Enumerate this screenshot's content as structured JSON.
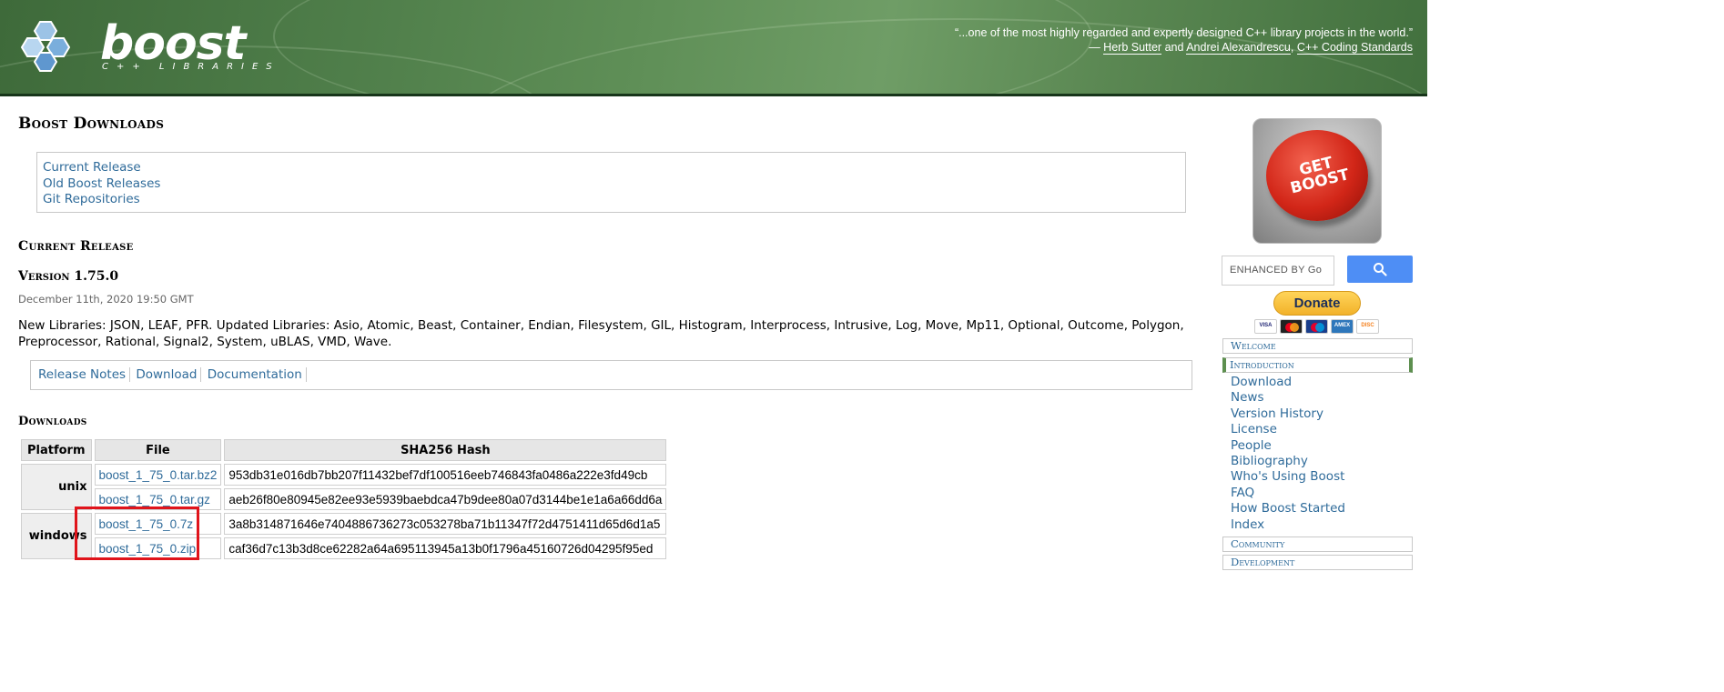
{
  "header": {
    "logo_word": "boost",
    "logo_sub": "C++ LIBRARIES",
    "quote_line1": "“...one of the most highly regarded and expertly designed C++ library projects in the world.”",
    "quote_dash": "— ",
    "quote_author1": "Herb Sutter",
    "quote_and": " and ",
    "quote_author2": "Andrei Alexandrescu",
    "quote_comma": ", ",
    "quote_book": "C++ Coding Standards"
  },
  "page_title": "Boost Downloads",
  "toc": [
    "Current Release",
    "Old Boost Releases",
    "Git Repositories"
  ],
  "current_release": {
    "heading": "Current Release",
    "version": "Version 1.75.0",
    "date": "December 11th, 2020 19:50 GMT",
    "description": "New Libraries: JSON, LEAF, PFR. Updated Libraries: Asio, Atomic, Beast, Container, Endian, Filesystem, GIL, Histogram, Interprocess, Intrusive, Log, Move, Mp11, Optional, Outcome, Polygon, Preprocessor, Rational, Signal2, System, uBLAS, VMD, Wave.",
    "links": [
      "Release Notes",
      "Download",
      "Documentation"
    ]
  },
  "downloads": {
    "heading": "Downloads",
    "columns": [
      "Platform",
      "File",
      "SHA256 Hash"
    ],
    "rows": [
      {
        "platform": "unix",
        "file": "boost_1_75_0.tar.bz2",
        "hash": "953db31e016db7bb207f11432bef7df100516eeb746843fa0486a222e3fd49cb"
      },
      {
        "platform": "",
        "file": "boost_1_75_0.tar.gz",
        "hash": "aeb26f80e80945e82ee93e5939baebdca47b9dee80a07d3144be1e1a6a66dd6a"
      },
      {
        "platform": "windows",
        "file": "boost_1_75_0.7z",
        "hash": "3a8b314871646e7404886736273c053278ba71b11347f72d4751411d65d6d1a5"
      },
      {
        "platform": "",
        "file": "boost_1_75_0.zip",
        "hash": "caf36d7c13b3d8ce62282a64a695113945a13b0f1796a45160726d04295f95ed"
      }
    ]
  },
  "sidebar": {
    "get_boost_text": "GET BOOST",
    "search_placeholder": "ENHANCED BY Go",
    "donate_label": "Donate",
    "cards": [
      "VISA",
      "MC",
      "MAE",
      "AMEX",
      "DISC"
    ],
    "sections": {
      "welcome": "Welcome",
      "introduction": "Introduction",
      "community": "Community",
      "development": "Development"
    },
    "intro_items": [
      "Download",
      "News",
      "Version History",
      "License",
      "People",
      "Bibliography",
      "Who's Using Boost",
      "FAQ",
      "How Boost Started",
      "Index"
    ]
  },
  "colors": {
    "link": "#2f6b9a",
    "highlight_box": "#e0141b",
    "header_green": "#4f7e4a",
    "search_button": "#4e8ef5"
  }
}
